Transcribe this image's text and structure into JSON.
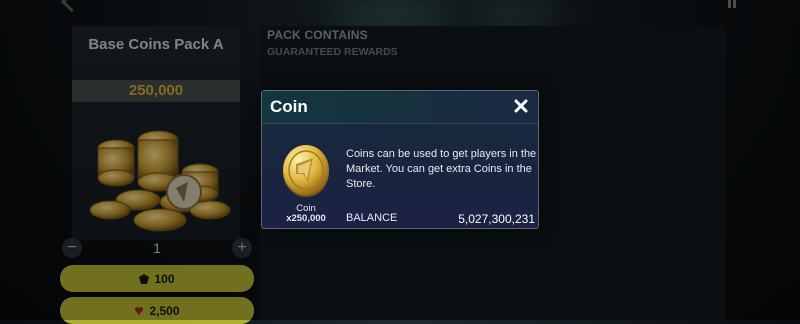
{
  "pack": {
    "title": "Base Coins Pack A",
    "amount": "250,000",
    "quantity": "1",
    "price_1": "100",
    "price_2": "2,500"
  },
  "contains": {
    "title": "PACK CONTAINS",
    "subtitle": "GUARANTEED REWARDS"
  },
  "modal": {
    "title": "Coin",
    "item_name": "Coin",
    "item_quantity": "x250,000",
    "description": "Coins can be used to get players in the Market. You can get extra Coins in the Store.",
    "balance_label": "BALANCE",
    "balance_value": "5,027,300,231"
  },
  "colors": {
    "price_button": "#c9c935",
    "pack_amount": "#c8a736",
    "modal_bg": "#1a2440",
    "coin_gold": "#e0b53c"
  }
}
